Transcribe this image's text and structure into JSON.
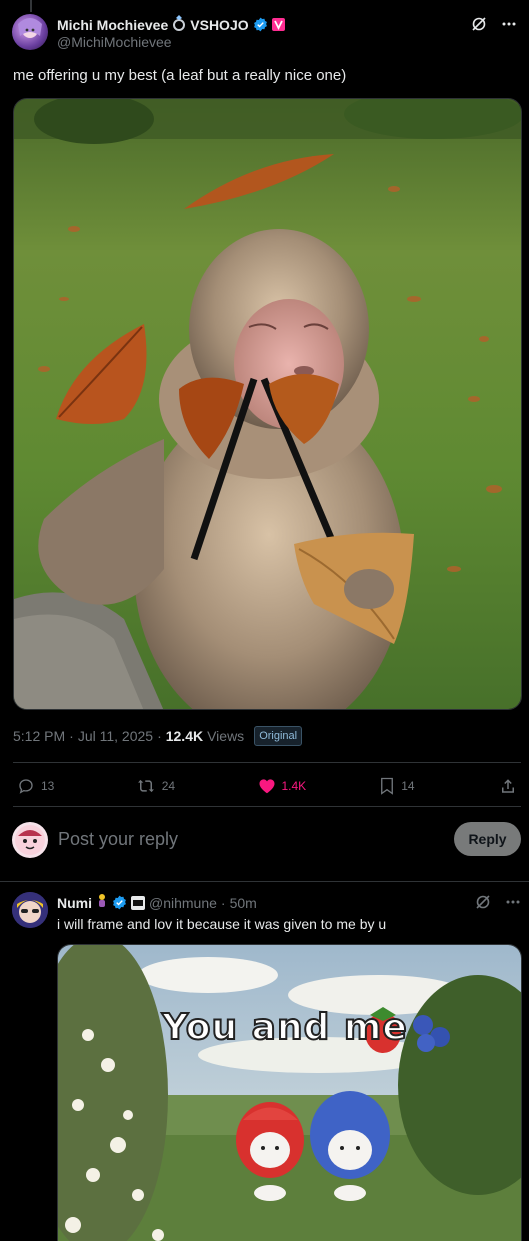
{
  "post": {
    "display_name": "Michi Mochievee",
    "affiliation": "VSHOJO",
    "handle": "@MichiMochievee",
    "text": "me offering u my best (a leaf but a really nice one)",
    "media_alt_icon": "monkey-with-leaves-photo",
    "time": "5:12 PM",
    "date": "Jul 11, 2025",
    "views_count": "12.4K",
    "views_label": "Views",
    "original_badge": "Original"
  },
  "actions": {
    "replies": "13",
    "reposts": "24",
    "likes": "1.4K",
    "bookmarks": "14"
  },
  "compose": {
    "placeholder": "Post your reply",
    "button": "Reply"
  },
  "reply": {
    "display_name": "Numi",
    "handle": "@nihmune",
    "time": "50m",
    "text": "i will frame and lov it because it was given to me by u",
    "media_caption": "You and me"
  },
  "colors": {
    "background": "#000000",
    "text": "#e7e9ea",
    "muted": "#71767b",
    "verified": "#1d9bf0",
    "like_active": "#f91880",
    "border": "#2f3336",
    "affiliate_badge": "#ff2d92"
  }
}
